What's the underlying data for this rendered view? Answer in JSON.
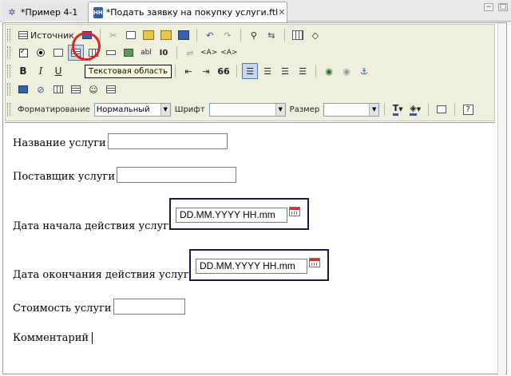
{
  "tabs": {
    "tab1_label": "*Пример 4-1",
    "tab2_label": "*Подать заявку на покупку услуги.ftl",
    "tab2_icon_text": "HH",
    "tab2_close": "✕",
    "min_glyph": "−",
    "max_glyph": "□"
  },
  "toolbar": {
    "source_label": "Источник",
    "bold": "B",
    "italic": "I",
    "underline": "U",
    "abl1": "abl",
    "abl2": "abl",
    "io": "I0",
    "tag1": "<A>",
    "tag2": "<A>",
    "quote": "66",
    "format_label": "Форматирование",
    "format_value": "Нормальный",
    "font_label": "Шрифт",
    "font_value": "",
    "size_label": "Размер",
    "size_value": "",
    "help": "?"
  },
  "tooltip": "Текстовая область",
  "form": {
    "service_name_label": "Название услуги",
    "supplier_label": "Поставщик услуги",
    "start_date_label": "Дата начала действия услуги",
    "start_date_value": "DD.MM.YYYY HH.mm",
    "end_date_label": "Дата окончания действия услуги",
    "end_date_value": "DD.MM.YYYY HH.mm",
    "cost_label": "Стоимость услуги",
    "comment_label": "Комментарий"
  }
}
